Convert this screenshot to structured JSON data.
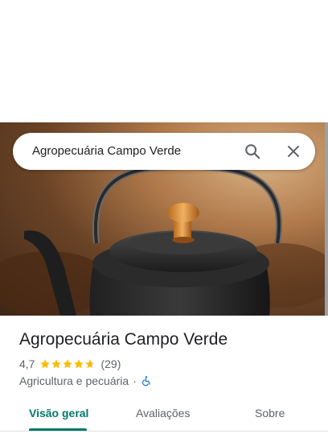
{
  "search": {
    "value": "Agropecuária Campo Verde"
  },
  "place": {
    "name": "Agropecuária Campo Verde",
    "rating": "4,7",
    "stars": 4.7,
    "review_count": "(29)",
    "category": "Agricultura e pecuária",
    "separator": "·"
  },
  "tabs": [
    {
      "label": "Visão geral",
      "active": true
    },
    {
      "label": "Avaliações",
      "active": false
    },
    {
      "label": "Sobre",
      "active": false
    }
  ],
  "colors": {
    "accent": "#00796b",
    "star": "#fbbc04",
    "accessibility": "#1a73e8"
  },
  "icons": [
    "search-icon",
    "close-icon",
    "star-icon",
    "wheelchair-icon"
  ]
}
